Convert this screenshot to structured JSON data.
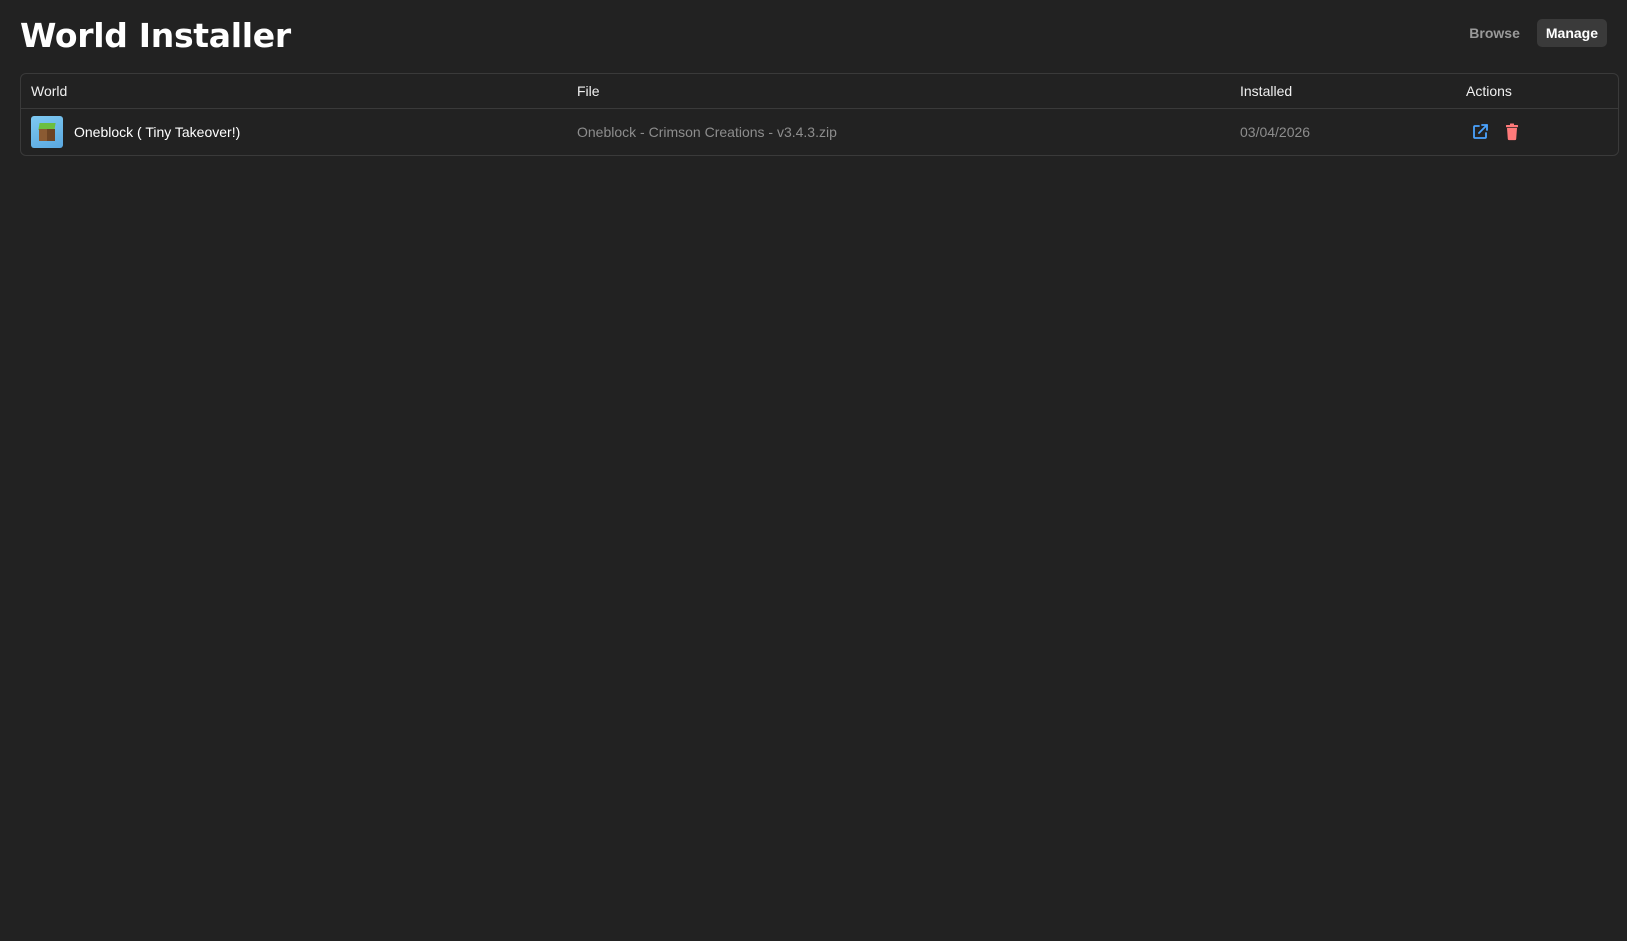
{
  "app": {
    "title": "World Installer"
  },
  "tabs": [
    {
      "label": "Browse",
      "active": false
    },
    {
      "label": "Manage",
      "active": true
    }
  ],
  "table": {
    "columns": [
      "World",
      "File",
      "Installed",
      "Actions"
    ],
    "rows": [
      {
        "world": "Oneblock ( Tiny Takeover!)",
        "file": "Oneblock - Crimson Creations - v3.4.3.zip",
        "installed": "03/04/2026",
        "actions": [
          "open-external-icon",
          "trash-icon"
        ]
      }
    ]
  },
  "colors": {
    "background": "#222222",
    "border": "#3a3a3a",
    "open_icon": "#4aa3ff",
    "delete_icon": "#ff7a7a",
    "muted_text": "#8d8d8d"
  }
}
